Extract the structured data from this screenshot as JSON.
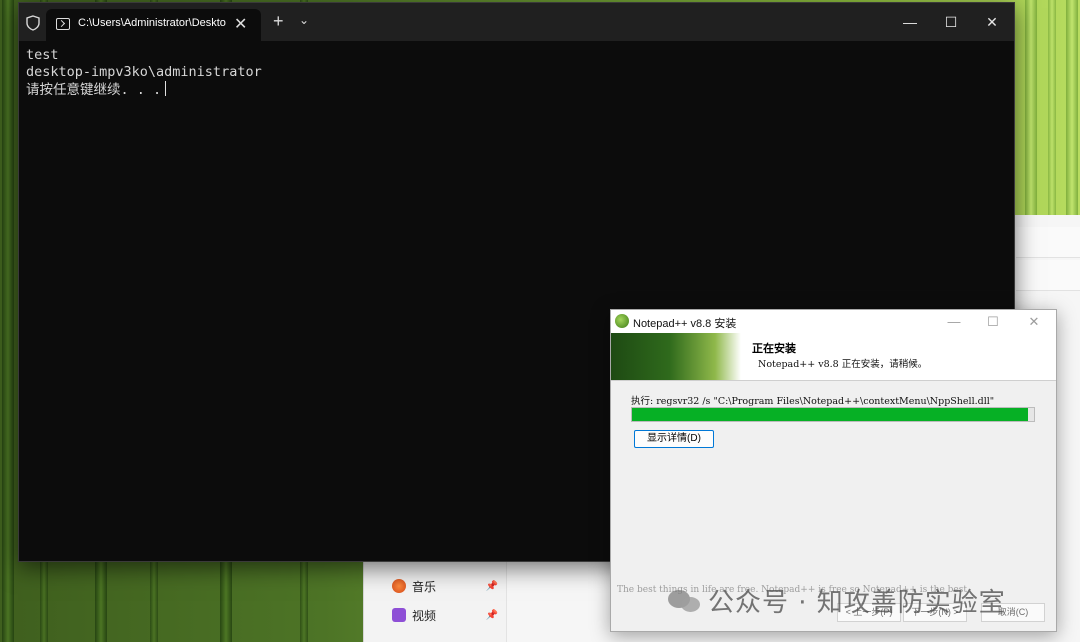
{
  "explorer": {
    "nav_items": [
      {
        "label": "音乐",
        "icon": "music-icon"
      },
      {
        "label": "视频",
        "icon": "video-icon"
      }
    ],
    "pin_icon": "pin-icon"
  },
  "terminal": {
    "tab_title": "C:\\Users\\Administrator\\Desktop",
    "tab_close": "✕",
    "new_tab": "+",
    "tab_dropdown": "⌄",
    "controls": {
      "minimize": "—",
      "maximize": "☐",
      "close": "✕"
    },
    "lines": [
      "test",
      "desktop-impv3ko\\administrator",
      "请按任意键继续. . ."
    ]
  },
  "installer": {
    "title": "Notepad++ v8.8 安装",
    "controls": {
      "minimize": "—",
      "maximize": "☐",
      "close": "✕"
    },
    "heading": "正在安装",
    "subheading": "Notepad++ v8.8 正在安装，请稍候。",
    "exec_text": "执行: regsvr32 /s \"C:\\Program Files\\Notepad++\\contextMenu\\NppShell.dll\"",
    "progress": 0.985,
    "details_button": "显示详情(D)",
    "footer": "The best things in life are free. Notepad++ is free so Notepad++ is the best",
    "back_button": "< 上一步(P)",
    "next_button": "下一步(N) >",
    "cancel_button": "取消(C)"
  },
  "watermark": {
    "text": "公众号 · 知攻善防实验室"
  },
  "colors": {
    "terminal_bg": "#0c0c0c",
    "progress": "#06b025",
    "accent": "#0078d7"
  }
}
